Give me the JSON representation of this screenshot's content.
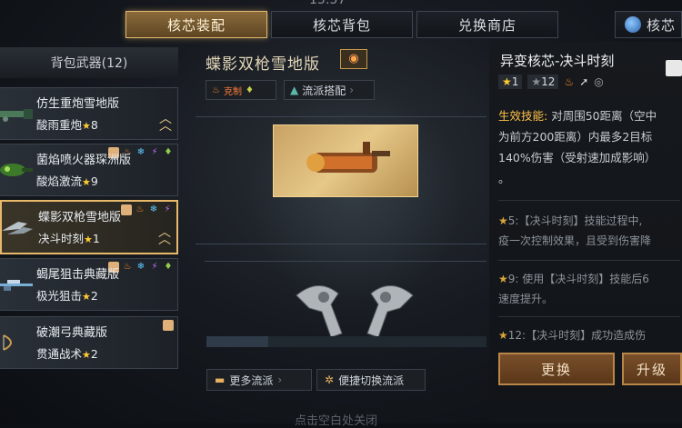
{
  "header": {
    "clock": "15:57",
    "tabs": [
      {
        "label": "核芯装配",
        "active": true
      },
      {
        "label": "核芯背包",
        "active": false
      },
      {
        "label": "兑换商店",
        "active": false
      },
      {
        "label": "核芯",
        "active": false
      }
    ]
  },
  "left": {
    "title": "背包武器(12)",
    "weapons": [
      {
        "name": "仿生重炮雪地版",
        "core": "酸雨重炮",
        "stars": "8"
      },
      {
        "name": "菌焰喷火器琛洲版",
        "core": "酸焰激流",
        "stars": "9"
      },
      {
        "name": "蝶影双枪雪地版",
        "core": "决斗时刻",
        "stars": "1"
      },
      {
        "name": "蝎尾狙击典藏版",
        "core": "极光狙击",
        "stars": "2"
      },
      {
        "name": "破潮弓典藏版",
        "core": "贯通战术",
        "stars": "2"
      }
    ]
  },
  "center": {
    "weapon_title": "蝶影双枪雪地版",
    "tag_counter": "克制",
    "tag_style": "流派搭配",
    "btn_more": "更多流派",
    "btn_switch": "便捷切换流派",
    "hint": "点击空白处关闭"
  },
  "right": {
    "title": "异变核芯-决斗时刻",
    "stat_star": "1",
    "stat_star2": "12",
    "skill_label": "生效技能:",
    "skill_lines": [
      "对周围50距离（空中",
      "为前方200距离）内最多2目标",
      "140%伤害（受射速加成影响）",
      "。"
    ],
    "bonus5": [
      "5:【决斗时刻】技能过程中,",
      "疫一次控制效果，且受到伤害降"
    ],
    "bonus9": [
      "9: 使用【决斗时刻】技能后6",
      "速度提升。"
    ],
    "bonus12": "12:【决斗时刻】成功造成伤",
    "btn_replace": "更换",
    "btn_upgrade": "升级"
  }
}
